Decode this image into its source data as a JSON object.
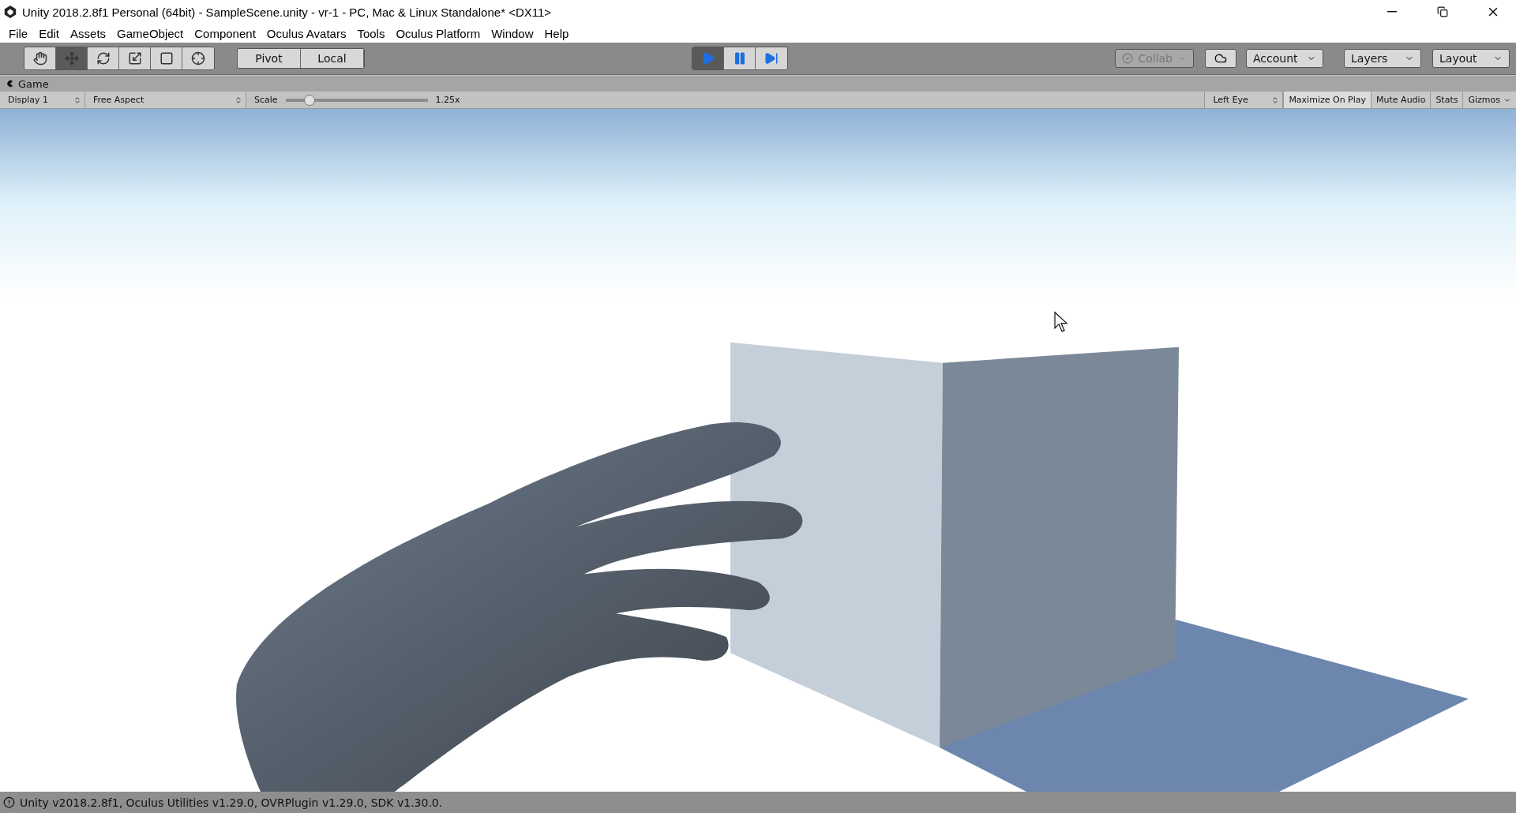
{
  "window": {
    "title": "Unity 2018.2.8f1 Personal (64bit) - SampleScene.unity - vr-1 - PC, Mac & Linux Standalone* <DX11>"
  },
  "menu": [
    "File",
    "Edit",
    "Assets",
    "GameObject",
    "Component",
    "Oculus Avatars",
    "Tools",
    "Oculus Platform",
    "Window",
    "Help"
  ],
  "toolbar": {
    "tools": [
      {
        "kind": "hand",
        "selected": false
      },
      {
        "kind": "move",
        "selected": true
      },
      {
        "kind": "rotate",
        "selected": false
      },
      {
        "kind": "scale",
        "selected": false
      },
      {
        "kind": "rect",
        "selected": false
      },
      {
        "kind": "transform",
        "selected": false
      }
    ],
    "pivot": [
      "Pivot",
      "Local"
    ],
    "playback": [
      {
        "kind": "play",
        "selected": true
      },
      {
        "kind": "pause",
        "selected": false
      },
      {
        "kind": "step",
        "selected": false
      }
    ],
    "collab": {
      "label": "Collab",
      "disabled": true
    },
    "account": "Account",
    "layers": "Layers",
    "layout": "Layout"
  },
  "game_panel": {
    "tab": "Game",
    "display": "Display 1",
    "aspect": "Free Aspect",
    "scale": {
      "label": "Scale",
      "level": 0.13,
      "reading": "1.25x"
    },
    "eye": "Left Eye",
    "toggles": [
      {
        "label": "Maximize On Play",
        "on": true
      },
      {
        "label": "Mute Audio",
        "on": false
      },
      {
        "label": "Stats",
        "on": false
      }
    ],
    "gizmos": "Gizmos"
  },
  "status_bar": "Unity v2018.2.8f1, Oculus Utilities v1.29.0, OVRPlugin v1.29.0, SDK v1.30.0."
}
